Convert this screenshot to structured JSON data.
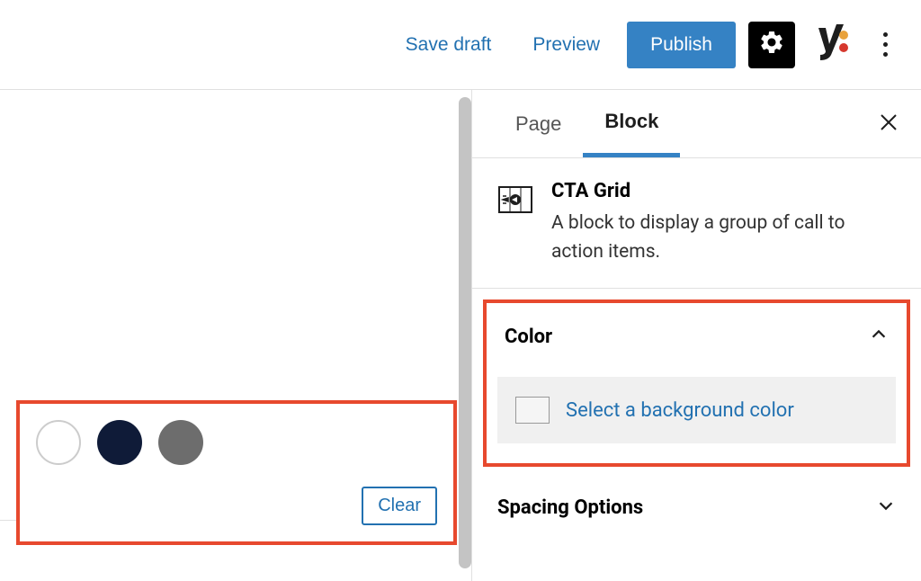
{
  "toolbar": {
    "save_draft": "Save draft",
    "preview": "Preview",
    "publish": "Publish"
  },
  "sidebar": {
    "tabs": {
      "page": "Page",
      "block": "Block"
    },
    "block": {
      "name": "CTA Grid",
      "description": "A block to display a group of call to action items."
    },
    "panels": {
      "color": {
        "title": "Color",
        "select_bg": "Select a background color"
      },
      "spacing": {
        "title": "Spacing Options"
      }
    }
  },
  "popover": {
    "clear": "Clear",
    "swatches": [
      {
        "name": "white",
        "hex": "#ffffff"
      },
      {
        "name": "navy",
        "hex": "#0f1b38"
      },
      {
        "name": "gray",
        "hex": "#6d6d6d"
      }
    ]
  }
}
